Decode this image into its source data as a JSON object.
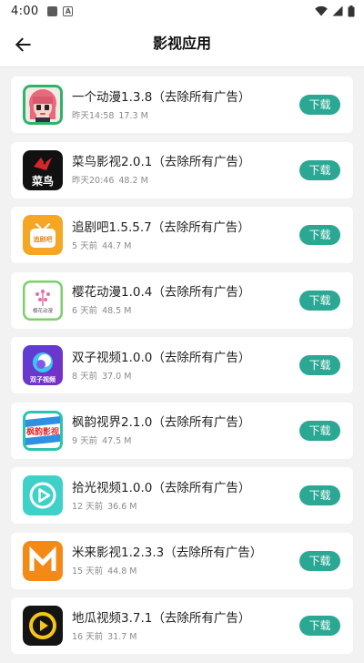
{
  "status_bar": {
    "time": "4:00",
    "notif_letter": "A",
    "icons": [
      "notification-square-icon",
      "accessibility-a-icon",
      "wifi-icon",
      "cell-signal-icon",
      "battery-icon"
    ]
  },
  "header": {
    "title": "影视应用",
    "back_icon": "arrow-left-icon"
  },
  "colors": {
    "accent": "#2aa893",
    "background": "#f2f2f2",
    "card": "#ffffff",
    "meta_text": "#8a8a8a"
  },
  "download_label": "下载",
  "apps": [
    {
      "name": "一个动漫1.3.8（去除所有广告）",
      "date": "昨天14:58",
      "size": "17.3 M",
      "icon": "anime-girl-icon"
    },
    {
      "name": "菜鸟影视2.0.1（去除所有广告）",
      "date": "昨天20:46",
      "size": "48.2 M",
      "icon": "cainiao-bird-icon",
      "icon_text": "菜鸟"
    },
    {
      "name": "追剧吧1.5.5.7（去除所有广告）",
      "date": "5 天前",
      "size": "44.7 M",
      "icon": "tv-icon",
      "icon_text": "追剧吧"
    },
    {
      "name": "樱花动漫1.0.4（去除所有广告）",
      "date": "6 天前",
      "size": "48.5 M",
      "icon": "sakura-icon",
      "icon_text": "樱花动漫"
    },
    {
      "name": "双子视频1.0.0（去除所有广告）",
      "date": "8 天前",
      "size": "37.0 M",
      "icon": "swirl-icon",
      "icon_text": "双子视频"
    },
    {
      "name": "枫韵视界2.1.0（去除所有广告）",
      "date": "9 天前",
      "size": "47.5 M",
      "icon": "fengyun-icon",
      "icon_text": "枫韵影视"
    },
    {
      "name": "拾光视频1.0.0（去除所有广告）",
      "date": "12 天前",
      "size": "36.6 M",
      "icon": "play-circle-icon"
    },
    {
      "name": "米来影视1.2.3.3（去除所有广告）",
      "date": "15 天前",
      "size": "44.8 M",
      "icon": "m-logo-icon"
    },
    {
      "name": "地瓜视频3.7.1（去除所有广告）",
      "date": "16 天前",
      "size": "31.7 M",
      "icon": "play-ring-icon"
    }
  ]
}
